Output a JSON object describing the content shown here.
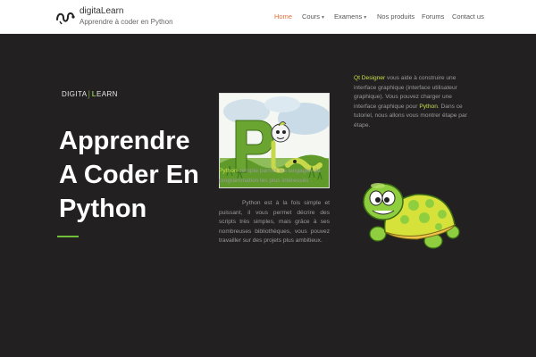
{
  "header": {
    "logo_title": "digitaLearn",
    "logo_subtitle": "Apprendre à coder en Python",
    "nav": [
      {
        "label": "Home",
        "active": true,
        "dropdown": false
      },
      {
        "label": "Cours",
        "active": false,
        "dropdown": true
      },
      {
        "label": "Examens",
        "active": false,
        "dropdown": true
      },
      {
        "label": "Nos produits",
        "active": false,
        "dropdown": false
      },
      {
        "label": "Forums",
        "active": false,
        "dropdown": false
      },
      {
        "label": "Contact us",
        "active": false,
        "dropdown": false
      }
    ],
    "chevron": "▾"
  },
  "hero": {
    "brand_left": "DIGITA",
    "brand_bar": "⌡L",
    "brand_right": "EARN",
    "title_lines": [
      "Apprendre",
      "A Coder En",
      "Python"
    ],
    "mid_para1": {
      "highlight": "Python",
      "text": " compte parmis les langages de programmation les plus intéressés ."
    },
    "mid_para2": "Python est à la fois simple et puissant, il vous permet décrire des scripts très simples, mais grâce à ses nombreuses bibliothèques, vous pouvez travailler sur des projets plus ambitieux.",
    "right_para": {
      "highlight1": "Qt Designer",
      "text1": "  vous aide à construire une interface graphique (interface utilisateur graphique). Vous pouvez charger une interface graphique pour ",
      "highlight2": "Python",
      "text2": ". Dans ce tutoriel, nous allons vous montrer étape par étape."
    }
  },
  "colors": {
    "hero_bg": "#222021",
    "accent_orange": "#e0703a",
    "accent_green": "#6fbf3a",
    "highlight_yellowgreen": "#c8e04a"
  },
  "icons": {
    "logo": "snake-logo-icon",
    "picture": "python-letters-snake-illustration",
    "turtle": "turtle-illustration"
  }
}
